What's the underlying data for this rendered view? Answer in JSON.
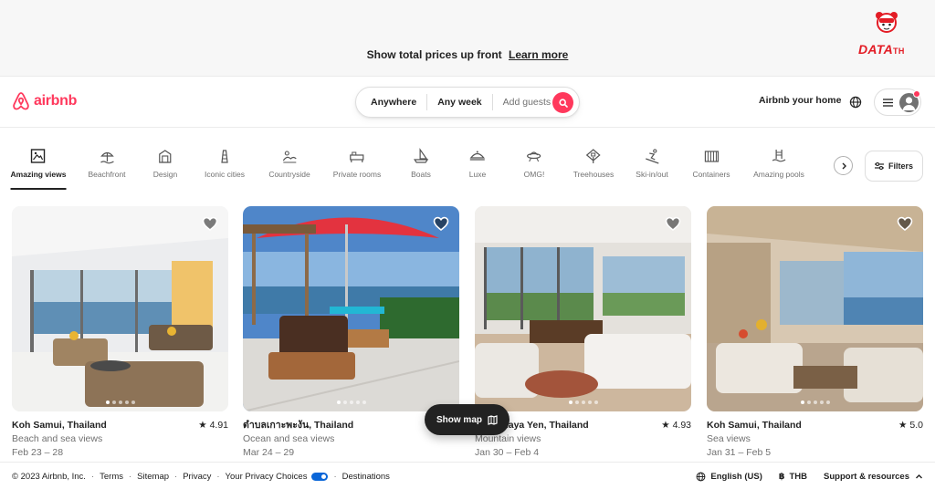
{
  "banner": {
    "text": "Show total prices up front",
    "link": "Learn more",
    "watermark": "DATA",
    "watermark_suffix": "TH"
  },
  "header": {
    "logo_text": "airbnb",
    "search": {
      "where": "Anywhere",
      "when": "Any week",
      "who": "Add guests"
    },
    "host_link": "Airbnb your home",
    "accent_color": "#ff385c"
  },
  "categories": [
    {
      "label": "Amazing views",
      "icon": "amazing-views-icon",
      "active": true
    },
    {
      "label": "Beachfront",
      "icon": "beachfront-icon"
    },
    {
      "label": "Design",
      "icon": "design-icon"
    },
    {
      "label": "Iconic cities",
      "icon": "iconic-cities-icon"
    },
    {
      "label": "Countryside",
      "icon": "countryside-icon"
    },
    {
      "label": "Private rooms",
      "icon": "private-rooms-icon"
    },
    {
      "label": "Boats",
      "icon": "boats-icon"
    },
    {
      "label": "Luxe",
      "icon": "luxe-icon"
    },
    {
      "label": "OMG!",
      "icon": "omg-icon"
    },
    {
      "label": "Treehouses",
      "icon": "treehouses-icon"
    },
    {
      "label": "Ski-in/out",
      "icon": "ski-icon"
    },
    {
      "label": "Containers",
      "icon": "containers-icon"
    },
    {
      "label": "Amazing pools",
      "icon": "amazing-pools-icon"
    }
  ],
  "filters_label": "Filters",
  "listings": [
    {
      "location": "Koh Samui, Thailand",
      "rating": "4.91",
      "description": "Beach and sea views",
      "dates": "Feb 23 – 28",
      "photo_count": 5,
      "photo_index": 0
    },
    {
      "location": "ตำบลเกาะพะงัน, Thailand",
      "rating": "",
      "description": "Ocean and sea views",
      "dates": "Mar 24 – 29",
      "photo_count": 5,
      "photo_index": 0
    },
    {
      "location": "Koh Phaya Yen, Thailand",
      "rating": "4.93",
      "description": "Mountain views",
      "dates": "Jan 30 – Feb 4",
      "photo_count": 5,
      "photo_index": 0
    },
    {
      "location": "Koh Samui, Thailand",
      "rating": "5.0",
      "description": "Sea views",
      "dates": "Jan 31 – Feb 5",
      "photo_count": 5,
      "photo_index": 0
    }
  ],
  "show_map_label": "Show map",
  "footer": {
    "copyright": "© 2023 Airbnb, Inc.",
    "links": [
      "Terms",
      "Sitemap",
      "Privacy",
      "Your Privacy Choices",
      "Destinations"
    ],
    "language": "English (US)",
    "currency": "THB",
    "support": "Support & resources"
  }
}
